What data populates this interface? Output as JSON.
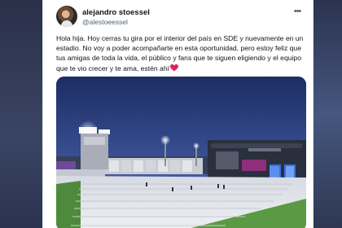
{
  "tweet": {
    "author_name": "alejandro stoessel",
    "author_handle": "@alestoeessel",
    "text": "Hola hija. Hoy cerras tu gira por el interior del país en SDE y nuevamente en un estadio. No voy a poder acompañarte en esta oportunidad, pero estoy feliz que tus amigas de toda la vida, el público y fans que te siguen eligiendo y el equipo que te vio crecer y te ama, estén ahí",
    "more_icon": "more-horizontal-icon",
    "emoji": "red-heart-icon"
  },
  "colors": {
    "heart": "#e0245e",
    "text": "#0f1419",
    "secondary_text": "#536471"
  }
}
